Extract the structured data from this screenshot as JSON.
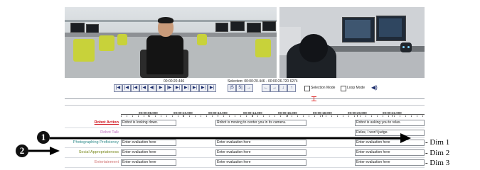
{
  "toolbar": {
    "current_time": "00:00:20.446",
    "selection": "Selection: 00:00:20.446 - 00:00:26.720  6274",
    "selection_mode_label": "Selection Mode",
    "loop_mode_label": "Loop Mode"
  },
  "timeline": {
    "ticks": [
      "00:00:08.000",
      "00:00:10.000",
      "00:00:12.000",
      "00:00:14.000",
      "00:00:16.000",
      "00:00:18.000",
      "00:00:20.000",
      "00:00:22.000"
    ]
  },
  "tracks": [
    {
      "label": "Robot Action",
      "color": "#d0141e",
      "cells": [
        "Robot is looking down.",
        "Robot is moving to center you in its camera.",
        "Robot is asking you to relax."
      ]
    },
    {
      "label": "Robot Talk",
      "color": "#c070c0",
      "cells": [
        "",
        "",
        "Relax, I won't judge."
      ]
    },
    {
      "label": "Photographing Proficiency",
      "color": "#2e8a8a",
      "cells": [
        "Enter evaluation here",
        "Enter evaluation here",
        "Enter evaluation here"
      ]
    },
    {
      "label": "Social Appropriateness",
      "color": "#7a8a1e",
      "cells": [
        "Enter evaluation here",
        "Enter evaluation here",
        "Enter evaluation here"
      ]
    },
    {
      "label": "Entertainment",
      "color": "#d07070",
      "cells": [
        "Enter evaluation here",
        "Enter evaluation here",
        "Enter evaluation here"
      ]
    }
  ],
  "annotations": {
    "badge_1": "1",
    "badge_2": "2",
    "dim_1": "- Dim 1",
    "dim_2": "- Dim 2",
    "dim_3": "- Dim 3"
  }
}
